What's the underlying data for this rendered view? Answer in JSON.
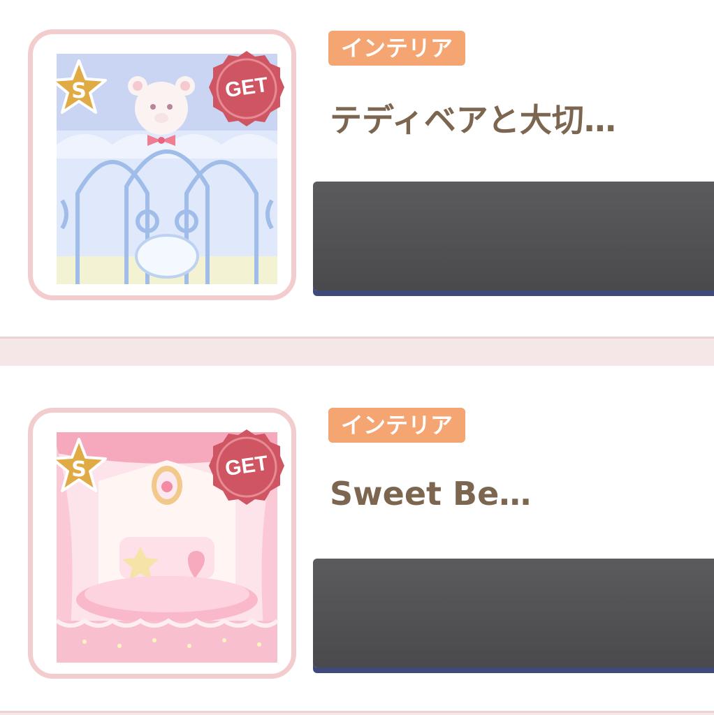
{
  "items": [
    {
      "category": "インテリア",
      "title": "テディベアと大切…",
      "rank": "S",
      "get_badge": "GET",
      "art_icon": "teddy-bear-window-interior-icon"
    },
    {
      "category": "インテリア",
      "title": "Sweet Be…",
      "rank": "S",
      "get_badge": "GET",
      "art_icon": "pink-sweet-bed-interior-icon"
    }
  ],
  "colors": {
    "tag_bg": "#f4a571",
    "title_text": "#7d6650",
    "frame_border": "#f3cdcd",
    "get_badge": "#d05563",
    "rank_star": "#e0aa45",
    "action_bar": "#555558",
    "separator": "#f5e7e7"
  }
}
